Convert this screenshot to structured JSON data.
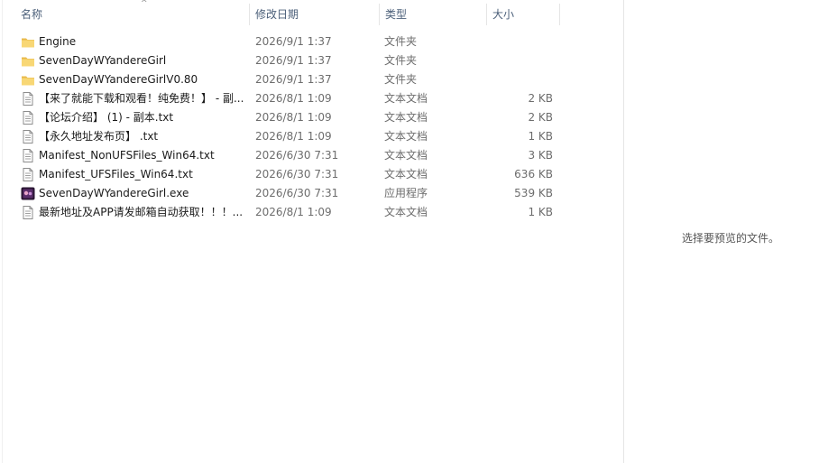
{
  "columns": {
    "name": "名称",
    "date": "修改日期",
    "type": "类型",
    "size": "大小"
  },
  "sort_indicator": "^",
  "files": [
    {
      "name": "Engine",
      "date": "2026/9/1 1:37",
      "type": "文件夹",
      "size": "",
      "icon": "folder-icon"
    },
    {
      "name": "SevenDayWYandereGirl",
      "date": "2026/9/1 1:37",
      "type": "文件夹",
      "size": "",
      "icon": "folder-icon"
    },
    {
      "name": "SevenDayWYandereGirlV0.80",
      "date": "2026/9/1 1:37",
      "type": "文件夹",
      "size": "",
      "icon": "folder-icon"
    },
    {
      "name": "【来了就能下载和观看！纯免费！】 - 副...",
      "date": "2026/8/1 1:09",
      "type": "文本文档",
      "size": "2 KB",
      "icon": "text-file-icon"
    },
    {
      "name": "【论坛介绍】 (1) - 副本.txt",
      "date": "2026/8/1 1:09",
      "type": "文本文档",
      "size": "2 KB",
      "icon": "text-file-icon"
    },
    {
      "name": "【永久地址发布页】 .txt",
      "date": "2026/8/1 1:09",
      "type": "文本文档",
      "size": "1 KB",
      "icon": "text-file-icon"
    },
    {
      "name": "Manifest_NonUFSFiles_Win64.txt",
      "date": "2026/6/30 7:31",
      "type": "文本文档",
      "size": "3 KB",
      "icon": "text-file-icon"
    },
    {
      "name": "Manifest_UFSFiles_Win64.txt",
      "date": "2026/6/30 7:31",
      "type": "文本文档",
      "size": "636 KB",
      "icon": "text-file-icon"
    },
    {
      "name": "SevenDayWYandereGirl.exe",
      "date": "2026/6/30 7:31",
      "type": "应用程序",
      "size": "539 KB",
      "icon": "app-icon"
    },
    {
      "name": "最新地址及APP请发邮箱自动获取！！！...",
      "date": "2026/8/1 1:09",
      "type": "文本文档",
      "size": "1 KB",
      "icon": "text-file-icon"
    }
  ],
  "preview": {
    "message": "选择要预览的文件。"
  },
  "colors": {
    "header_text": "#4c607a",
    "folder": "#f8d775",
    "folder_dark": "#e9b949",
    "muted_text": "#6d6d6d"
  }
}
